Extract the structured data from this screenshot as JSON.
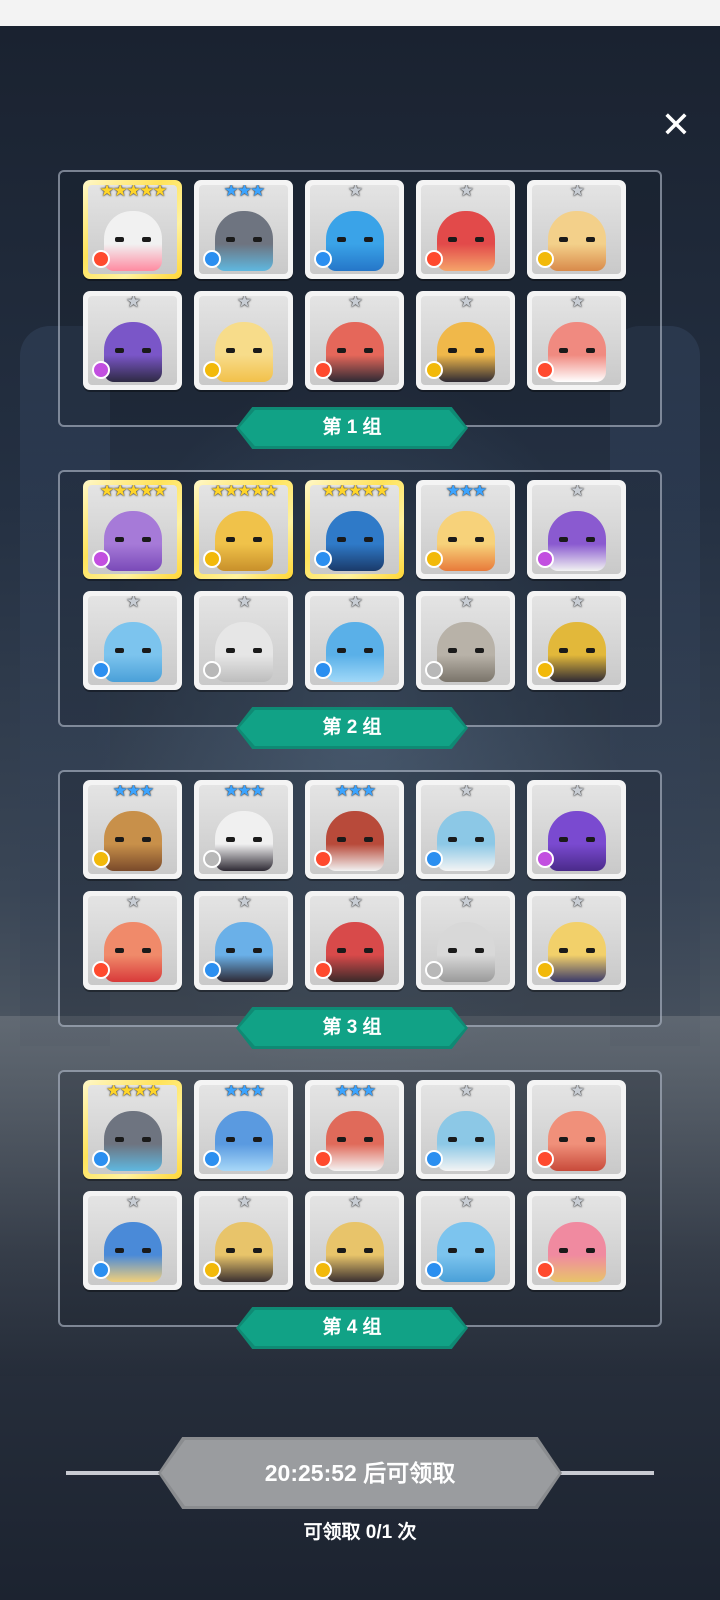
{
  "close_icon": "✕",
  "groups": [
    {
      "label": "第 1 组",
      "heroes": [
        {
          "stars": 5,
          "element": "fire",
          "color": "#f1f1f1",
          "accent": "#ff8aa0",
          "legendary": true
        },
        {
          "stars": 3,
          "element": "water",
          "color": "#6e7480",
          "accent": "#5fb8e0"
        },
        {
          "stars": 1,
          "element": "water",
          "color": "#3aa3e8",
          "accent": "#2576c8"
        },
        {
          "stars": 1,
          "element": "fire",
          "color": "#e24a4a",
          "accent": "#f5a46a"
        },
        {
          "stars": 1,
          "element": "earth",
          "color": "#f3d08a",
          "accent": "#d98a4a"
        },
        {
          "stars": 1,
          "element": "dark",
          "color": "#7a56c8",
          "accent": "#2e2a44"
        },
        {
          "stars": 1,
          "element": "earth",
          "color": "#f7dc8a",
          "accent": "#f2c14a"
        },
        {
          "stars": 1,
          "element": "fire",
          "color": "#e5675a",
          "accent": "#2e2a34"
        },
        {
          "stars": 1,
          "element": "earth",
          "color": "#f0b84a",
          "accent": "#2e2a34"
        },
        {
          "stars": 1,
          "element": "fire",
          "color": "#f08a80",
          "accent": "#ffffff"
        }
      ]
    },
    {
      "label": "第 2 组",
      "heroes": [
        {
          "stars": 5,
          "element": "dark",
          "color": "#a67ad8",
          "accent": "#7a4ab8",
          "legendary": true
        },
        {
          "stars": 5,
          "element": "earth",
          "color": "#f0c24a",
          "accent": "#c8902a",
          "legendary": true
        },
        {
          "stars": 5,
          "element": "water",
          "color": "#2f7ac8",
          "accent": "#1a3a6a",
          "legendary": true
        },
        {
          "stars": 3,
          "element": "earth",
          "color": "#f7d27a",
          "accent": "#e87a3a"
        },
        {
          "stars": 1,
          "element": "dark",
          "color": "#8a5ad0",
          "accent": "#f2f2f2"
        },
        {
          "stars": 1,
          "element": "water",
          "color": "#7cc4ee",
          "accent": "#4aa0d8"
        },
        {
          "stars": 1,
          "element": "light",
          "color": "#e6e6e6",
          "accent": "#bdbdbd"
        },
        {
          "stars": 1,
          "element": "water",
          "color": "#5ab0e8",
          "accent": "#a0d8f8"
        },
        {
          "stars": 1,
          "element": "light",
          "color": "#b8b2a8",
          "accent": "#7a746a"
        },
        {
          "stars": 1,
          "element": "earth",
          "color": "#e2b83a",
          "accent": "#2e2a34"
        }
      ]
    },
    {
      "label": "第 3 组",
      "heroes": [
        {
          "stars": 3,
          "element": "earth",
          "color": "#c8904a",
          "accent": "#7a4a2a"
        },
        {
          "stars": 3,
          "element": "light",
          "color": "#f0f0f0",
          "accent": "#2e2a34"
        },
        {
          "stars": 3,
          "element": "fire",
          "color": "#b84a3a",
          "accent": "#f2f2f2"
        },
        {
          "stars": 1,
          "element": "water",
          "color": "#8cc8e6",
          "accent": "#f4f4f4"
        },
        {
          "stars": 1,
          "element": "dark",
          "color": "#7a4ad0",
          "accent": "#4a2a8a"
        },
        {
          "stars": 1,
          "element": "fire",
          "color": "#f08a6a",
          "accent": "#d83a3a"
        },
        {
          "stars": 1,
          "element": "water",
          "color": "#6ab0e8",
          "accent": "#2e2a34"
        },
        {
          "stars": 1,
          "element": "fire",
          "color": "#d84a4a",
          "accent": "#3a2a2a"
        },
        {
          "stars": 1,
          "element": "light",
          "color": "#d8d8d8",
          "accent": "#9a9a9a"
        },
        {
          "stars": 1,
          "element": "earth",
          "color": "#f2d06a",
          "accent": "#3a3a6a"
        }
      ]
    },
    {
      "label": "第 4 组",
      "heroes": [
        {
          "stars": 4,
          "element": "water",
          "color": "#6e7480",
          "accent": "#5fb8e0",
          "legendary": true
        },
        {
          "stars": 3,
          "element": "water",
          "color": "#5a9ae0",
          "accent": "#a8d8f8"
        },
        {
          "stars": 3,
          "element": "fire",
          "color": "#e06a5a",
          "accent": "#f4f4f4"
        },
        {
          "stars": 1,
          "element": "water",
          "color": "#8cc8e6",
          "accent": "#f4f4f4"
        },
        {
          "stars": 1,
          "element": "fire",
          "color": "#f0907a",
          "accent": "#c84a3a"
        },
        {
          "stars": 1,
          "element": "water",
          "color": "#4a8ad8",
          "accent": "#f2d07a"
        },
        {
          "stars": 1,
          "element": "earth",
          "color": "#e8c46a",
          "accent": "#3a3030"
        },
        {
          "stars": 1,
          "element": "earth",
          "color": "#e8c46a",
          "accent": "#3a3030"
        },
        {
          "stars": 1,
          "element": "water",
          "color": "#7cc4ee",
          "accent": "#4aa0d8"
        },
        {
          "stars": 1,
          "element": "fire",
          "color": "#f08aa0",
          "accent": "#e8c46a"
        }
      ]
    }
  ],
  "timer": {
    "text": "20:25:52 后可领取"
  },
  "claim_count": "可领取 0/1 次",
  "colors": {
    "group_label_bg": "#11a286",
    "timer_bg": "#9a9c9f"
  }
}
